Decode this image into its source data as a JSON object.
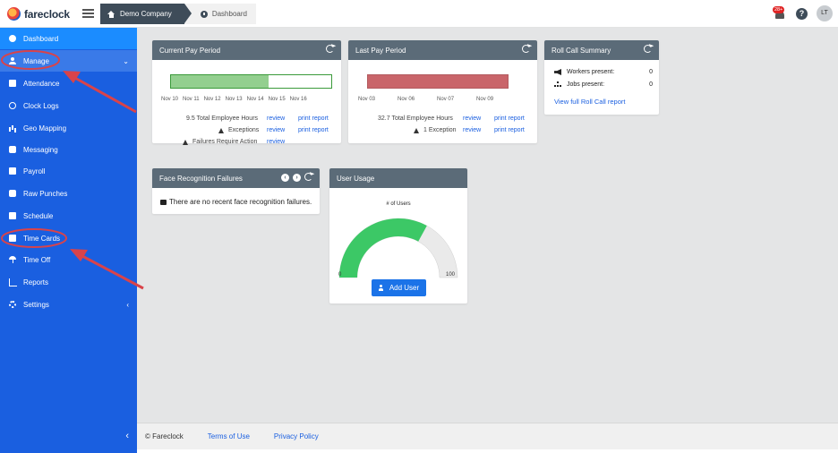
{
  "app": {
    "name": "fareclock"
  },
  "breadcrumb": {
    "company": "Demo Company",
    "page": "Dashboard"
  },
  "header": {
    "notification_count": "28+",
    "help_label": "?",
    "user_initials": "LT"
  },
  "sidebar": {
    "items": [
      {
        "label": "Dashboard",
        "icon": "dashboard-icon"
      },
      {
        "label": "Manage",
        "icon": "user-icon"
      },
      {
        "label": "Attendance",
        "icon": "calendar-icon"
      },
      {
        "label": "Clock Logs",
        "icon": "history-icon"
      },
      {
        "label": "Geo Mapping",
        "icon": "map-icon"
      },
      {
        "label": "Messaging",
        "icon": "chat-icon"
      },
      {
        "label": "Payroll",
        "icon": "money-icon"
      },
      {
        "label": "Raw Punches",
        "icon": "car-icon"
      },
      {
        "label": "Schedule",
        "icon": "schedule-icon"
      },
      {
        "label": "Time Cards",
        "icon": "timecard-icon"
      },
      {
        "label": "Time Off",
        "icon": "umbrella-icon"
      },
      {
        "label": "Reports",
        "icon": "chart-icon"
      },
      {
        "label": "Settings",
        "icon": "gear-icon"
      }
    ],
    "manage_chevron": "⌄",
    "settings_chevron": "‹",
    "collapse": "‹"
  },
  "current_pay_period": {
    "title": "Current Pay Period",
    "ticks": [
      "Nov 10",
      "Nov 11",
      "Nov 12",
      "Nov 13",
      "Nov 14",
      "Nov 15",
      "Nov 16"
    ],
    "progress": 0.61,
    "hours_text": "9.5 Total Employee Hours",
    "exceptions_text": "Exceptions",
    "failures_text": "Failures Require Action",
    "review": "review",
    "print_report": "print report"
  },
  "last_pay_period": {
    "title": "Last Pay Period",
    "ticks": [
      "Nov 03",
      "Nov 06",
      "Nov 07",
      "Nov 09"
    ],
    "progress": 1.0,
    "hours_text": "32.7 Total Employee Hours",
    "exceptions_text": "1 Exception",
    "review": "review",
    "print_report": "print report"
  },
  "roll_call": {
    "title": "Roll Call Summary",
    "workers_label": "Workers present:",
    "workers_value": "0",
    "jobs_label": "Jobs present:",
    "jobs_value": "0",
    "link": "View full Roll Call report"
  },
  "face_recognition": {
    "title": "Face Recognition Failures",
    "message": "There are no recent face recognition failures.",
    "prev": "‹",
    "next": "›"
  },
  "user_usage": {
    "title": "User Usage",
    "chart_label": "# of Users",
    "min": "0",
    "max": "100",
    "value_fraction": 0.66,
    "button": "Add User"
  },
  "footer": {
    "copyright": "© Fareclock",
    "terms": "Terms of Use",
    "privacy": "Privacy Policy"
  },
  "colors": {
    "sidebar": "#1a5fe0",
    "sidebar_active": "#1b8cff",
    "green": "#3cc866",
    "red": "#c9656a",
    "annotation": "#d9434a"
  }
}
